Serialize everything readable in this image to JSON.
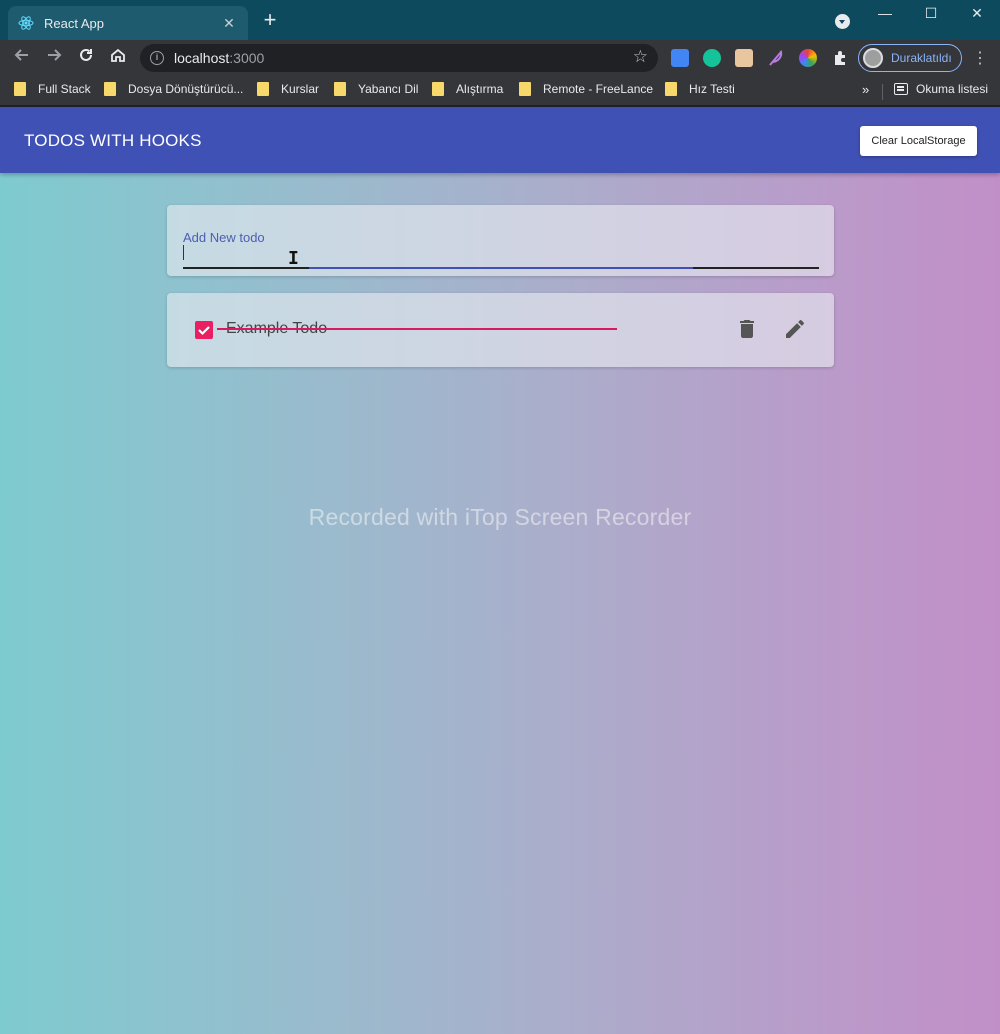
{
  "browser": {
    "tab": {
      "title": "React App",
      "favicon": "react-icon",
      "close": "✕"
    },
    "new_tab": "+",
    "window_controls": {
      "minimize": "—",
      "maximize": "☐",
      "close": "✕"
    },
    "url": {
      "host": "localhost",
      "port": ":3000"
    },
    "profile_label": "Duraklatıldı",
    "bookmarks": [
      "Full Stack",
      "Dosya Dönüştürücü...",
      "Kurslar",
      "Yabancı Dil",
      "Alıştırma",
      "Remote - FreeLance",
      "Hız Testi"
    ],
    "bookmarks_more": "»",
    "reading_list": "Okuma listesi",
    "extensions": [
      "translate-icon",
      "grammarly-icon",
      "avatar-extension-icon",
      "feather-icon",
      "color-wheel-icon",
      "puzzle-icon"
    ]
  },
  "app": {
    "title": "TODOS WITH HOOKS",
    "clear_button": "Clear LocalStorage",
    "input": {
      "label": "Add New todo",
      "value": ""
    },
    "todos": [
      {
        "text": "Example Todo",
        "completed": true
      }
    ],
    "accent_color": "#3f51b5",
    "check_color": "#e91e63"
  },
  "overlay": {
    "watermark": "Recorded with iTop Screen Recorder"
  }
}
